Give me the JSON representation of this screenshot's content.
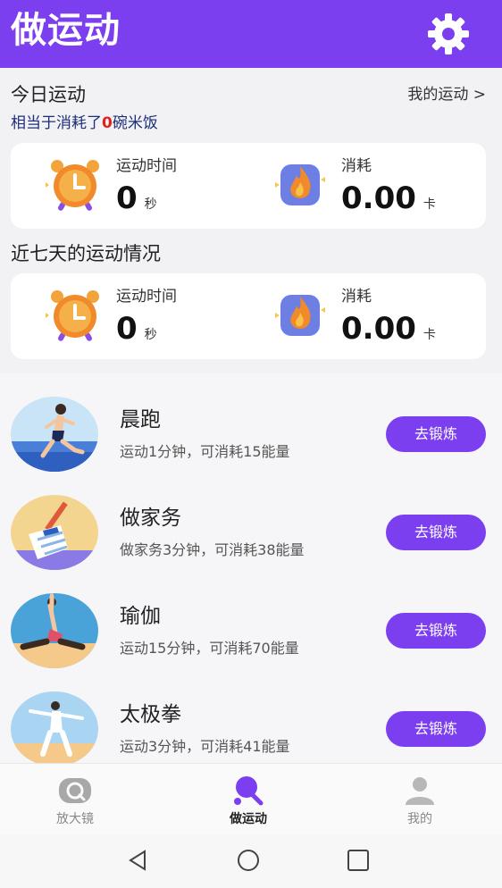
{
  "header": {
    "title": "做运动",
    "settings_icon": "gear-icon"
  },
  "today": {
    "title": "今日运动",
    "my_link": "我的运动 >",
    "equiv_prefix": "相当于消耗了",
    "equiv_count": "0",
    "equiv_suffix": "碗米饭",
    "time_label": "运动时间",
    "time_value": "0",
    "time_unit": "秒",
    "burn_label": "消耗",
    "burn_value": "0.00",
    "burn_unit": "卡"
  },
  "week": {
    "title": "近七天的运动情况",
    "time_label": "运动时间",
    "time_value": "0",
    "time_unit": "秒",
    "burn_label": "消耗",
    "burn_value": "0.00",
    "burn_unit": "卡"
  },
  "activities": [
    {
      "name": "晨跑",
      "desc": "运动1分钟，可消耗15能量",
      "button": "去锻炼"
    },
    {
      "name": "做家务",
      "desc": "做家务3分钟，可消耗38能量",
      "button": "去锻炼"
    },
    {
      "name": "瑜伽",
      "desc": "运动15分钟，可消耗70能量",
      "button": "去锻炼"
    },
    {
      "name": "太极拳",
      "desc": "运动3分钟，可消耗41能量",
      "button": "去锻炼"
    }
  ],
  "tabs": [
    {
      "label": "放大镜",
      "icon": "magnifier-icon"
    },
    {
      "label": "做运动",
      "icon": "ping-pong-icon"
    },
    {
      "label": "我的",
      "icon": "person-icon"
    }
  ],
  "colors": {
    "accent": "#7b3ff0",
    "highlight": "#e0201a"
  }
}
